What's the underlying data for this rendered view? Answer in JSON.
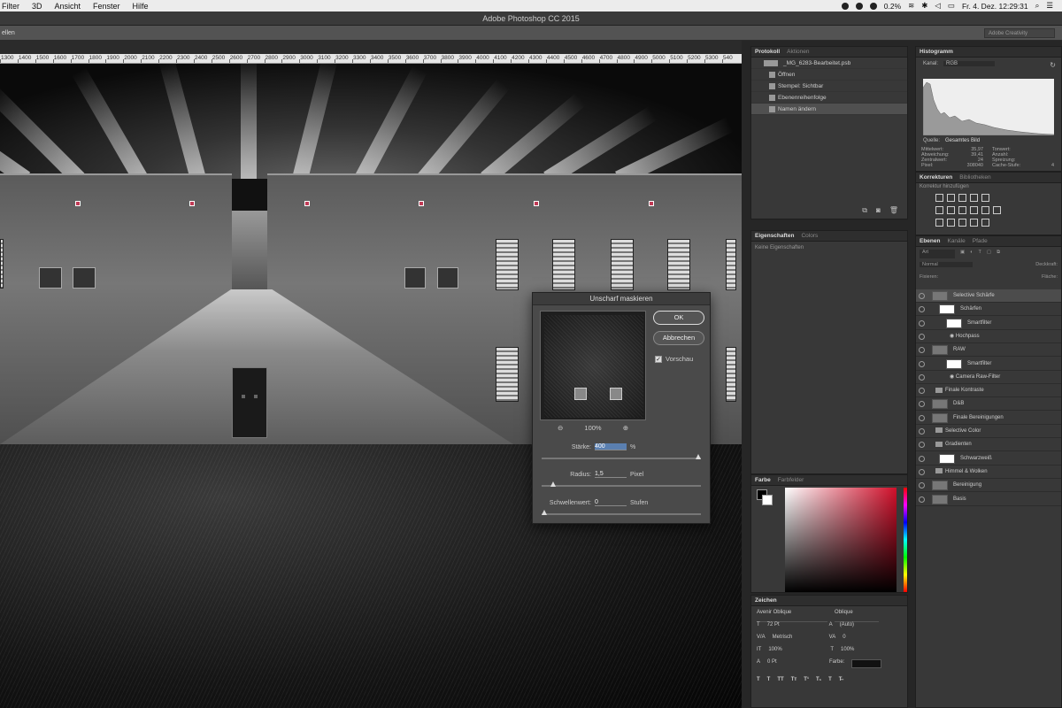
{
  "menubar": {
    "items": [
      "Filter",
      "3D",
      "Ansicht",
      "Fenster",
      "Hilfe"
    ],
    "battery": "0.2%",
    "clock": "Fr. 4. Dez.  12:29:31"
  },
  "window": {
    "title": "Adobe Photoshop CC 2015"
  },
  "optionsbar": {
    "left": "ellen",
    "workspace": "Adobe Creativity"
  },
  "ruler": {
    "ticks": [
      "1300",
      "1400",
      "1500",
      "1600",
      "1700",
      "1800",
      "1900",
      "2000",
      "2100",
      "2200",
      "2300",
      "2400",
      "2500",
      "2600",
      "2700",
      "2800",
      "2900",
      "3000",
      "3100",
      "3200",
      "3300",
      "3400",
      "3500",
      "3600",
      "3700",
      "3800",
      "3900",
      "4000",
      "4100",
      "4200",
      "4300",
      "4400",
      "4500",
      "4600",
      "4700",
      "4800",
      "4900",
      "5000",
      "5100",
      "5200",
      "5300",
      "540"
    ]
  },
  "dialog": {
    "title": "Unscharf maskieren",
    "ok": "OK",
    "cancel": "Abbrechen",
    "preview_label": "Vorschau",
    "zoom": "100%",
    "amount": {
      "label": "Stärke:",
      "value": "400",
      "unit": "%",
      "slider": 1.0
    },
    "radius": {
      "label": "Radius:",
      "value": "1,5",
      "unit": "Pixel",
      "slider": 0.06
    },
    "threshold": {
      "label": "Schwellenwert:",
      "value": "0",
      "unit": "Stufen",
      "slider": 0.0
    }
  },
  "protokoll": {
    "tabs": [
      "Protokoll",
      "Aktionen"
    ],
    "doc": "_MG_6283-Bearbeitet.psb",
    "items": [
      "Öffnen",
      "Stempel: Sichtbar",
      "Ebenenreihenfolge",
      "Namen ändern"
    ]
  },
  "histogramm": {
    "tab": "Histogramm",
    "kanal_label": "Kanal:",
    "kanal_value": "RGB",
    "quelle_label": "Quelle:",
    "quelle_value": "Gesamtes Bild",
    "stats_left": [
      [
        "Mittelwert:",
        "35,97"
      ],
      [
        "Abweichung:",
        "39,41"
      ],
      [
        "Zentralwert:",
        "24"
      ],
      [
        "Pixel:",
        "308040"
      ]
    ],
    "stats_right": [
      [
        "Tonwert:",
        ""
      ],
      [
        "Anzahl:",
        ""
      ],
      [
        "Spreizung:",
        ""
      ],
      [
        "Cache-Stufe:",
        "4"
      ]
    ]
  },
  "korrekturen": {
    "tabs": [
      "Korrekturen",
      "Bibliotheken"
    ],
    "add_label": "Korrektur hinzufügen"
  },
  "eigenschaften": {
    "tabs": [
      "Eigenschaften",
      "Colors"
    ],
    "empty": "Keine Eigenschaften"
  },
  "ebenen": {
    "tabs": [
      "Ebenen",
      "Kanäle",
      "Pfade"
    ],
    "filter_label": "Art",
    "mode": "Normal",
    "opacity_label": "Deckkraft:",
    "fix_label": "Fixieren:",
    "fill_label": "Fläche:",
    "layers": [
      {
        "name": "Selective Schärfe",
        "indent": 1,
        "type": "layer"
      },
      {
        "name": "Schärfen",
        "indent": 2,
        "type": "layer"
      },
      {
        "name": "Smartfilter",
        "indent": 3,
        "type": "layer"
      },
      {
        "name": "Hochpass",
        "indent": 3,
        "type": "filter"
      },
      {
        "name": "RAW",
        "indent": 1,
        "type": "layer"
      },
      {
        "name": "Smartfilter",
        "indent": 3,
        "type": "layer"
      },
      {
        "name": "Camera Raw-Filter",
        "indent": 3,
        "type": "filter"
      },
      {
        "name": "Finale Kontraste",
        "indent": 1,
        "type": "folder"
      },
      {
        "name": "D&B",
        "indent": 1,
        "type": "layer"
      },
      {
        "name": "Finale Bereinigungen",
        "indent": 1,
        "type": "layer"
      },
      {
        "name": "Selective Color",
        "indent": 1,
        "type": "folder"
      },
      {
        "name": "Gradienten",
        "indent": 1,
        "type": "folder"
      },
      {
        "name": "Schwarzweiß",
        "indent": 2,
        "type": "layer"
      },
      {
        "name": "Himmel & Wolken",
        "indent": 1,
        "type": "folder"
      },
      {
        "name": "Bereinigung",
        "indent": 1,
        "type": "layer"
      },
      {
        "name": "Basis",
        "indent": 1,
        "type": "layer"
      }
    ]
  },
  "farbe": {
    "tabs": [
      "Farbe",
      "Farbfelder"
    ],
    "accent": "#d10f2a"
  },
  "zeichen": {
    "tab": "Zeichen",
    "font": "Avenir Oblique",
    "style": "Oblique",
    "size": "72 Pt",
    "leading": "(Auto)",
    "kerning": "Metrisch",
    "tracking": "0",
    "vscale": "100%",
    "hscale": "100%",
    "baseline": "0 Pt",
    "color_label": "Farbe:",
    "styles": [
      "T",
      "T",
      "TT",
      "Tт",
      "T¹",
      "T₁",
      "T",
      "T̶"
    ]
  }
}
